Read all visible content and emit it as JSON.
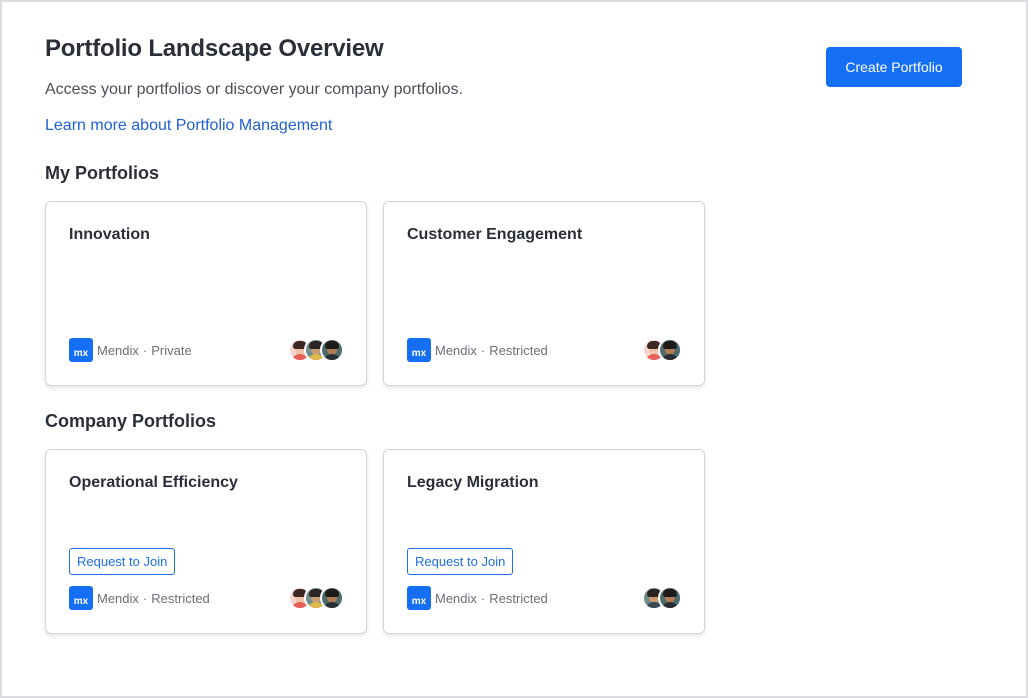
{
  "header": {
    "title": "Portfolio Landscape Overview",
    "subtitle": "Access your portfolios or discover your company portfolios.",
    "learn_link": "Learn more about Portfolio Management",
    "create_button": "Create Portfolio"
  },
  "my_portfolios": {
    "title": "My Portfolios",
    "cards": [
      {
        "title": "Innovation",
        "org": "Mendix",
        "visibility": "Private",
        "avatar_count": 3
      },
      {
        "title": "Customer Engagement",
        "org": "Mendix",
        "visibility": "Restricted",
        "avatar_count": 2
      }
    ]
  },
  "company_portfolios": {
    "title": "Company Portfolios",
    "cards": [
      {
        "title": "Operational Efficiency",
        "org": "Mendix",
        "visibility": "Restricted",
        "join_label": "Request to Join",
        "avatar_count": 3
      },
      {
        "title": "Legacy Migration",
        "org": "Mendix",
        "visibility": "Restricted",
        "join_label": "Request to Join",
        "avatar_count": 2
      }
    ]
  },
  "logo": {
    "text": "mx",
    "color": "#146ff4"
  },
  "separator": "·",
  "colors": {
    "accent": "#146ff4",
    "link": "#1f5fd6",
    "text": "#2b2f3a",
    "muted": "#6b6f78"
  }
}
